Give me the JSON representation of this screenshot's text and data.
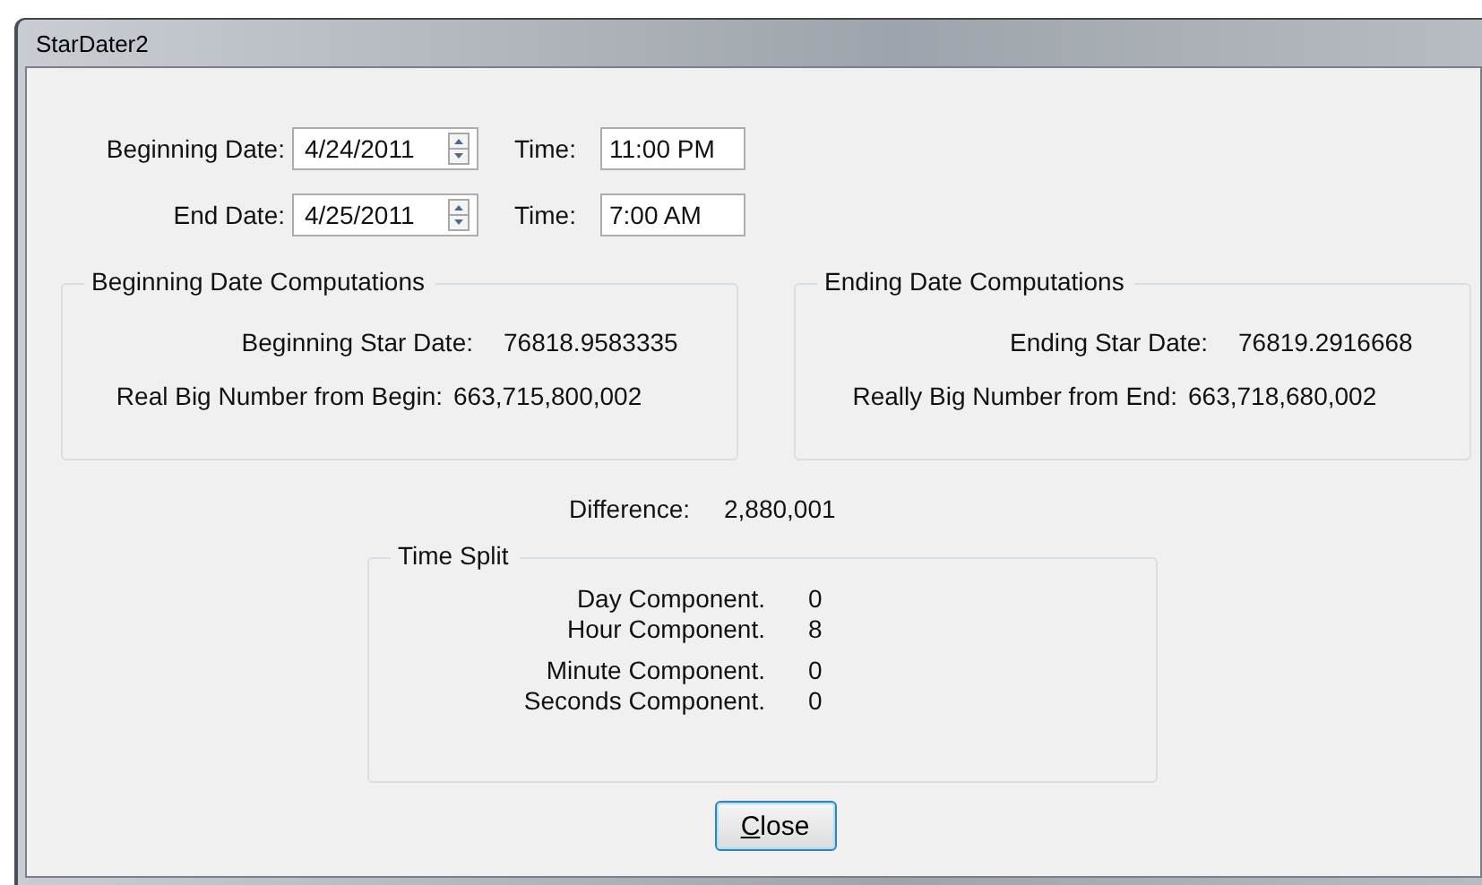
{
  "window": {
    "title": "StarDater2"
  },
  "inputs": [
    {
      "date_label": "Beginning Date:",
      "date": "4/24/2011",
      "time_label": "Time:",
      "time": "11:00 PM"
    },
    {
      "date_label": "End Date:",
      "date": "4/25/2011",
      "time_label": "Time:",
      "time": "7:00 AM"
    }
  ],
  "groups": [
    {
      "title": "Beginning Date Computations",
      "rows": [
        {
          "label": "Beginning Star Date:",
          "value": "76818.9583335"
        },
        {
          "label": "Real Big Number from Begin:",
          "value": "663,715,800,002"
        }
      ]
    },
    {
      "title": "Ending Date Computations",
      "rows": [
        {
          "label": "Ending Star Date:",
          "value": "76819.2916668"
        },
        {
          "label": "Really Big Number from End:",
          "value": "663,718,680,002"
        }
      ]
    }
  ],
  "difference": {
    "label": "Difference:",
    "value": "2,880,001"
  },
  "time_split": {
    "title": "Time Split",
    "rows": [
      {
        "label": "Day Component.",
        "value": "0"
      },
      {
        "label": "Hour Component.",
        "value": "8"
      },
      {
        "label": "Minute Component.",
        "value": "0"
      },
      {
        "label": "Seconds Component.",
        "value": "0"
      }
    ]
  },
  "buttons": [
    {
      "label": "Close"
    }
  ]
}
